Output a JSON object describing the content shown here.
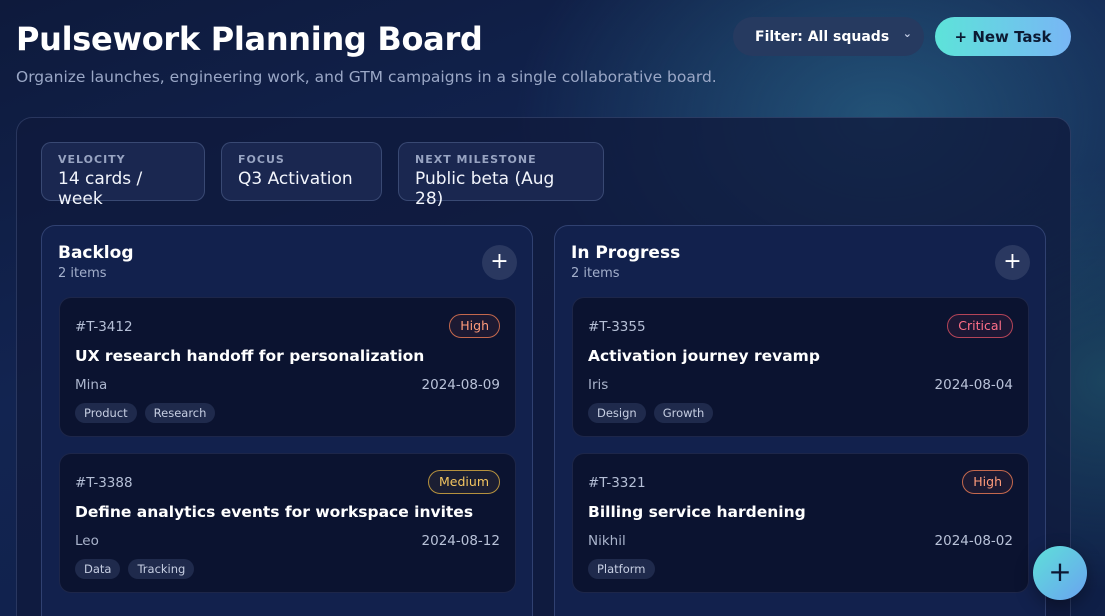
{
  "header": {
    "title": "Pulsework Planning Board",
    "subtitle": "Organize launches, engineering work, and GTM campaigns in a single collaborative board."
  },
  "toolbar": {
    "filter_label": "Filter: All squads",
    "new_task_label": "+ New Task"
  },
  "stats": [
    {
      "label": "VELOCITY",
      "value": "14 cards / week"
    },
    {
      "label": "FOCUS",
      "value": "Q3 Activation"
    },
    {
      "label": "NEXT MILESTONE",
      "value": "Public beta (Aug 28)"
    }
  ],
  "columns": [
    {
      "title": "Backlog",
      "count": "2 items",
      "cards": [
        {
          "id": "#T-3412",
          "priority": "High",
          "title": "UX research handoff for personalization",
          "owner": "Mina",
          "date": "2024-08-09",
          "tags": [
            "Product",
            "Research"
          ]
        },
        {
          "id": "#T-3388",
          "priority": "Medium",
          "title": "Define analytics events for workspace invites",
          "owner": "Leo",
          "date": "2024-08-12",
          "tags": [
            "Data",
            "Tracking"
          ]
        }
      ]
    },
    {
      "title": "In Progress",
      "count": "2 items",
      "cards": [
        {
          "id": "#T-3355",
          "priority": "Critical",
          "title": "Activation journey revamp",
          "owner": "Iris",
          "date": "2024-08-04",
          "tags": [
            "Design",
            "Growth"
          ]
        },
        {
          "id": "#T-3321",
          "priority": "High",
          "title": "Billing service hardening",
          "owner": "Nikhil",
          "date": "2024-08-02",
          "tags": [
            "Platform"
          ]
        }
      ]
    }
  ],
  "colors": {
    "accent_start": "#5de3d9",
    "accent_end": "#78b6f5",
    "priority_high": "#ff9b7a",
    "priority_critical": "#ff6f88",
    "priority_medium": "#f3c560"
  },
  "icons": {
    "filter_chevron": "chevron-down-icon",
    "column_add": "plus-icon",
    "fab": "plus-icon"
  }
}
